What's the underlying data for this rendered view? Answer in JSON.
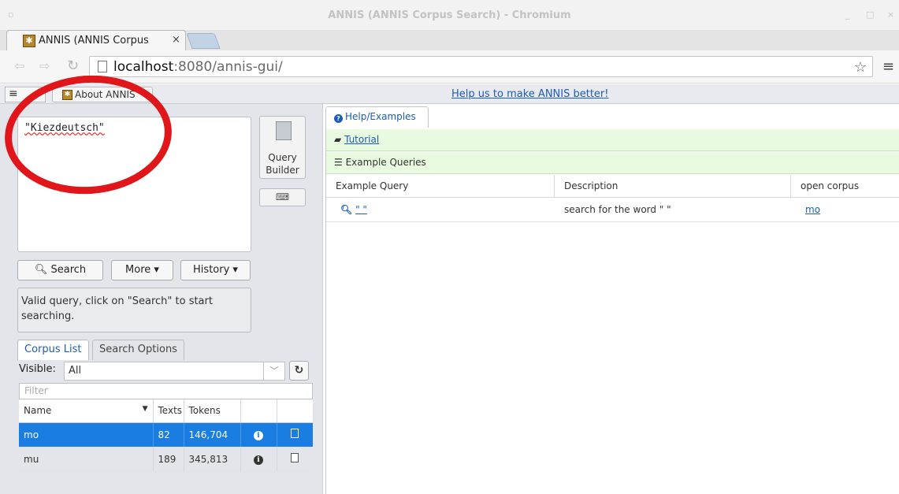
{
  "window": {
    "title": "ANNIS (ANNIS Corpus Search) - Chromium",
    "min": "_",
    "max": "□",
    "close": "×"
  },
  "browser": {
    "tab_title": "ANNIS (ANNIS Corpus",
    "tab_close": "×",
    "url_host": "localhost",
    "url_path": ":8080/annis-gui/"
  },
  "header": {
    "menu_icon": "≡",
    "about_label": "About ANNIS",
    "help_link": "Help us to make ANNIS better!"
  },
  "query": {
    "text": "\"Kiezdeutsch\"",
    "builder_label_1": "Query",
    "builder_label_2": "Builder",
    "keyboard_label": "⌨",
    "search_label": "Search",
    "more_label": "More ▾",
    "history_label": "History ▾",
    "status": "Valid query, click on \"Search\" to start searching."
  },
  "corpus": {
    "tabs": [
      "Corpus List",
      "Search Options"
    ],
    "visible_label": "Visible:",
    "visible_value": "All",
    "filter_placeholder": "Filter",
    "columns": [
      "Name",
      "Texts",
      "Tokens"
    ],
    "rows": [
      {
        "name": "mo",
        "texts": "82",
        "tokens": "146,704",
        "selected": true
      },
      {
        "name": "mu",
        "texts": "189",
        "tokens": "345,813",
        "selected": false
      }
    ]
  },
  "help": {
    "tab_label": "Help/Examples",
    "tutorial_label": "Tutorial",
    "examples_label": "Example Queries",
    "columns": [
      "Example Query",
      "Description",
      "open corpus browser"
    ],
    "rows": [
      {
        "query": "\" \"",
        "description": "search for the word \" \"",
        "corpus": "mo"
      }
    ]
  },
  "colors": {
    "accent": "#197de1",
    "link": "#1b5db6",
    "annotation": "#e0161b"
  }
}
